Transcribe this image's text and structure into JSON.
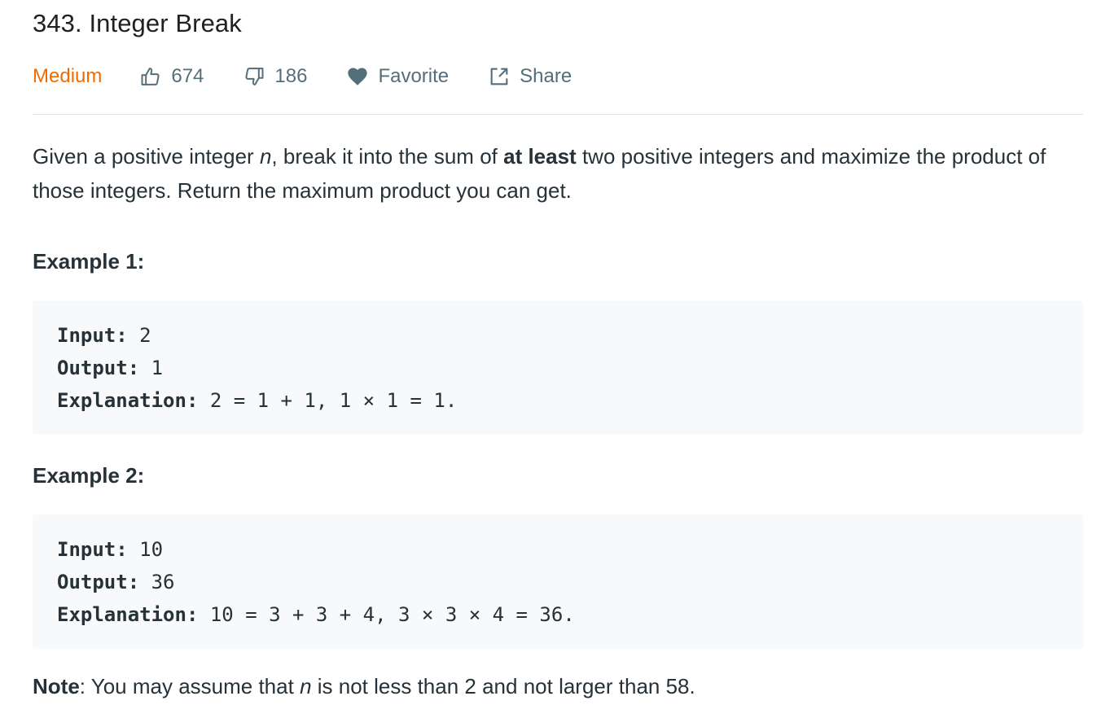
{
  "problem": {
    "title": "343. Integer Break",
    "difficulty": "Medium",
    "likes": "674",
    "dislikes": "186",
    "favorite_label": "Favorite",
    "share_label": "Share"
  },
  "description": {
    "p1_a": "Given a positive integer ",
    "p1_var": "n",
    "p1_b": ", break it into the sum of ",
    "p1_bold": "at least",
    "p1_c": " two positive integers and maximize the product of those integers. Return the maximum product you can get.",
    "example1_title": "Example 1:",
    "example2_title": "Example 2:",
    "note_label": "Note",
    "note_a": ": You may assume that ",
    "note_var": "n",
    "note_b": " is not less than 2 and not larger than 58."
  },
  "examples": [
    {
      "input_label": "Input:",
      "input_value": " 2",
      "output_label": "Output:",
      "output_value": " 1",
      "explanation_label": "Explanation:",
      "explanation_value": " 2 = 1 + 1, 1 × 1 = 1."
    },
    {
      "input_label": "Input:",
      "input_value": " 10",
      "output_label": "Output:",
      "output_value": " 36",
      "explanation_label": "Explanation:",
      "explanation_value": " 10 = 3 + 3 + 4, 3 × 3 × 4 = 36."
    }
  ],
  "colors": {
    "difficulty_medium": "#ef6c00",
    "meta_text": "#546e7a",
    "code_background": "#f7f9fa"
  },
  "icons": {
    "like": "thumbs-up-icon",
    "dislike": "thumbs-down-icon",
    "favorite": "heart-icon",
    "share": "share-icon"
  }
}
